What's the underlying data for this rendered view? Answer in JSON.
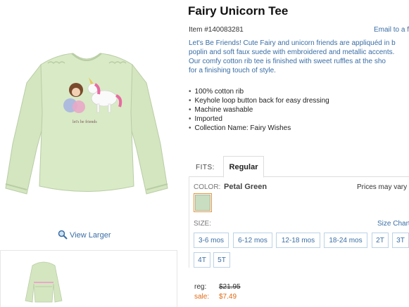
{
  "product": {
    "title": "Fairy Unicorn Tee",
    "item_number": "Item #140083281",
    "email_link": "Email to a friend",
    "description": [
      "Let's Be Friends! Cute Fairy and unicorn friends are appliquéd in b",
      "poplin and soft faux suede with embroidered and metallic accents.",
      "Our comfy cotton rib tee is finished with sweet ruffles at the sho",
      "for a finishing touch of style."
    ],
    "features": [
      "100% cotton rib",
      "Keyhole loop button back for easy dressing",
      "Machine washable",
      "Imported",
      "Collection Name: Fairy Wishes"
    ],
    "image_text": "let's be friends"
  },
  "gallery": {
    "view_larger": "View Larger"
  },
  "fits": {
    "label": "FITS:",
    "selected": "Regular"
  },
  "color": {
    "label": "COLOR:",
    "value": "Petal Green",
    "swatch_hex": "#c9ddc0",
    "prices_note": "Prices may vary"
  },
  "size": {
    "label": "SIZE:",
    "chart_link": "Size Chart",
    "options": [
      "3-6 mos",
      "6-12 mos",
      "12-18 mos",
      "18-24 mos",
      "2T",
      "3T",
      "4T",
      "5T"
    ]
  },
  "pricing": {
    "reg_label": "reg:",
    "reg_price": "$21.95",
    "sale_label": "sale:",
    "sale_price": "$7.49"
  },
  "colors": {
    "link": "#3a6ea5",
    "sale": "#e06b14",
    "shirt": "#d4e6c0",
    "swatch_border": "#e8953a"
  }
}
